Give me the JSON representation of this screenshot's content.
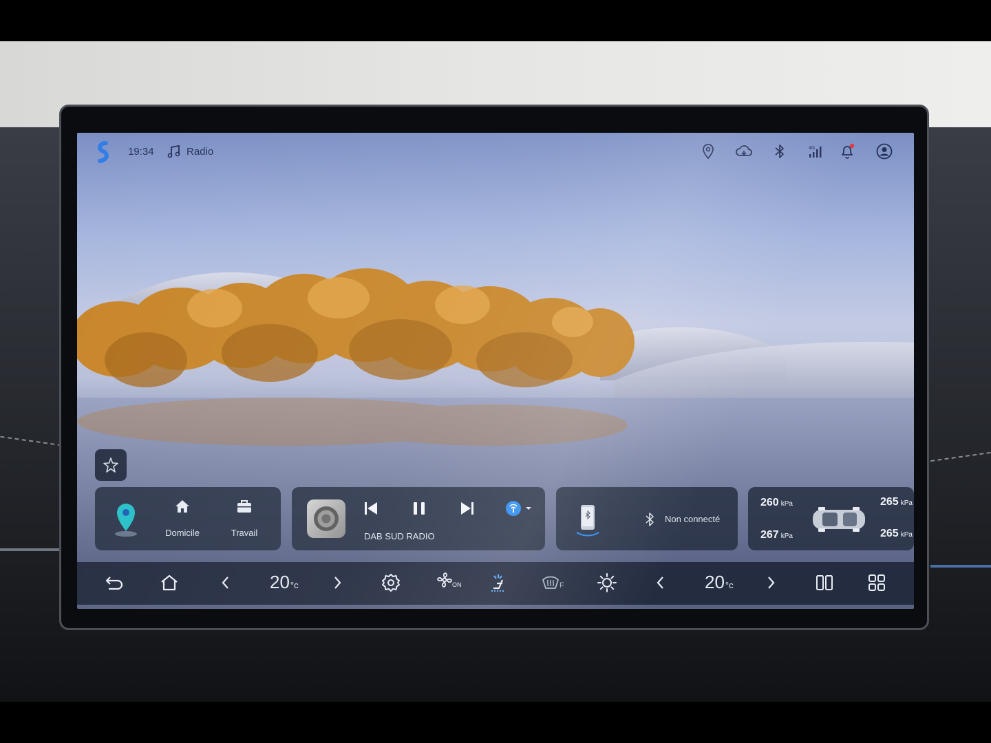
{
  "status_bar": {
    "time": "19:34",
    "source_label": "Radio",
    "icons": [
      "location-icon",
      "cloud-sync-icon",
      "bluetooth-icon",
      "signal-4g-icon",
      "notification-bell-icon",
      "user-profile-icon"
    ],
    "notification_badge_color": "#e0383e"
  },
  "navigation_card": {
    "shortcuts": [
      {
        "label": "Domicile",
        "icon": "home-icon"
      },
      {
        "label": "Travail",
        "icon": "briefcase-icon"
      }
    ]
  },
  "media_card": {
    "station": "DAB SUD RADIO",
    "controls": [
      "previous-track-icon",
      "pause-icon",
      "next-track-icon"
    ]
  },
  "phone_card": {
    "bluetooth_status": "Non connecté"
  },
  "tire_pressure": {
    "unit": "kPa",
    "front_left": "260",
    "rear_left": "267",
    "front_right": "265",
    "rear_right": "265"
  },
  "dock": {
    "driver_temp": "20",
    "passenger_temp": "20",
    "temp_unit": "°c",
    "fan_state": "ON",
    "defrost_label": "F",
    "icons": [
      "back-icon",
      "home-icon",
      "chevron-left-icon",
      "chevron-right-icon",
      "settings-gear-icon",
      "fan-on-icon",
      "seat-airflow-icon",
      "front-defrost-icon",
      "brightness-icon",
      "chevron-left-icon",
      "chevron-right-icon",
      "split-screen-icon",
      "app-grid-icon"
    ]
  },
  "colors": {
    "accent_blue": "#2f8df0",
    "pin_teal": "#27c0c8",
    "card_bg": "#263042"
  }
}
